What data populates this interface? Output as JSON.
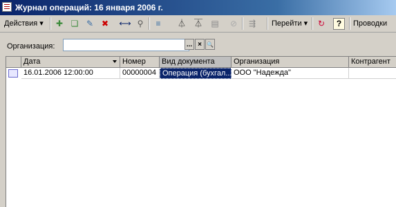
{
  "window": {
    "title": "Журнал операций: 16 января 2006 г."
  },
  "toolbar": {
    "actions_label": "Действия",
    "goto_label": "Перейти",
    "postings_label": "Проводки",
    "help_label": "?"
  },
  "filter": {
    "label": "Организация:",
    "value": "",
    "select_label": "...",
    "clear_label": "×",
    "search_label": "🔍"
  },
  "table": {
    "columns": [
      "Дата",
      "Номер",
      "Вид документа",
      "Организация",
      "Контрагент"
    ],
    "rows": [
      {
        "date": "16.01.2006 12:00:00",
        "number": "00000004",
        "doc_type": "Операция (бухгал...",
        "org": "ООО \"Надежда\"",
        "counterparty": ""
      }
    ]
  },
  "colors": {
    "title_start": "#0a246a",
    "selection": "#0a246a"
  }
}
